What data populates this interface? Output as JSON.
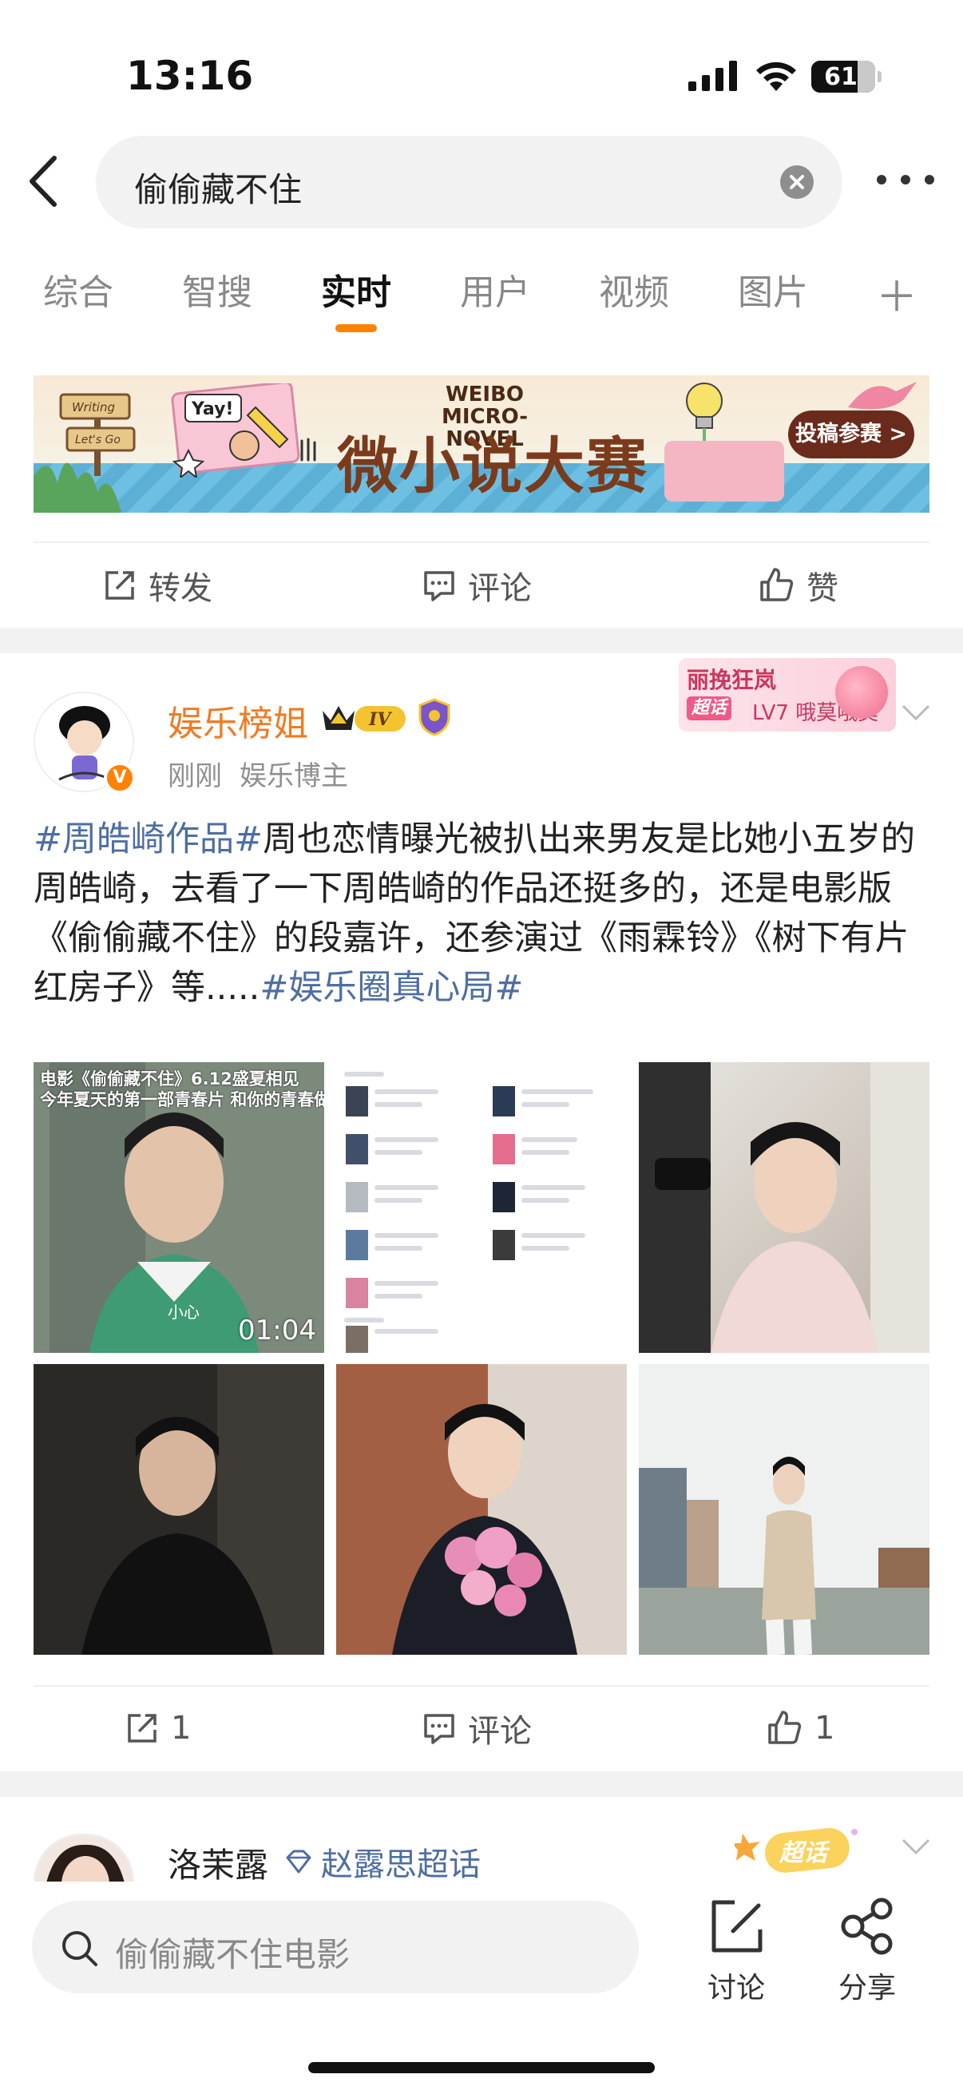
{
  "status": {
    "time": "13:16",
    "battery": "61"
  },
  "search": {
    "query": "偷偷藏不住"
  },
  "tabs": [
    "综合",
    "智搜",
    "实时",
    "用户",
    "视频",
    "图片"
  ],
  "active_tab": "实时",
  "banner": {
    "brand": "WEIBO MICRO-NOVEL",
    "title": "微小说大赛",
    "cta": "投稿参赛 >",
    "sign_text": [
      "Writing",
      "Let's Go"
    ],
    "sticker": "Yay!"
  },
  "ad_actions": {
    "repost": "转发",
    "comment": "评论",
    "like": "赞"
  },
  "post": {
    "username": "娱乐榜姐",
    "level_badge": "IV",
    "time": "刚刚",
    "source": "娱乐博主",
    "fan_card": {
      "name": "丽挽狂岚",
      "tag": "超话",
      "level": "LV7 哦莫哦莫"
    },
    "text": {
      "topic1": "#周皓崎作品#",
      "content": "周也恋情曝光被扒出来男友是比她小五岁的周皓崎，去看了一下周皓崎的作品还挺多的，还是电影版《偷偷藏不住》的段嘉许，还参演过《雨霖铃》《树下有片红房子》等.....",
      "topic2": "#娱乐圈真心局#"
    },
    "video": {
      "caption1": "电影《偷偷藏不住》6.12盛夏相见",
      "caption2": "今年夏天的第一部青春片 和你的青春做一次纪念",
      "subtitle": "小心",
      "duration": "01:04"
    },
    "actions": {
      "repost": "1",
      "comment": "评论",
      "like": "1"
    }
  },
  "post2": {
    "username": "洛茉露",
    "topic": "赵露思超话",
    "badge": "超话"
  },
  "bottom": {
    "placeholder": "偷偷藏不住电影",
    "discuss": "讨论",
    "share": "分享"
  },
  "colors": {
    "accent": "#ff8200",
    "topic": "#4e6ea3",
    "username": "#f07b22"
  }
}
